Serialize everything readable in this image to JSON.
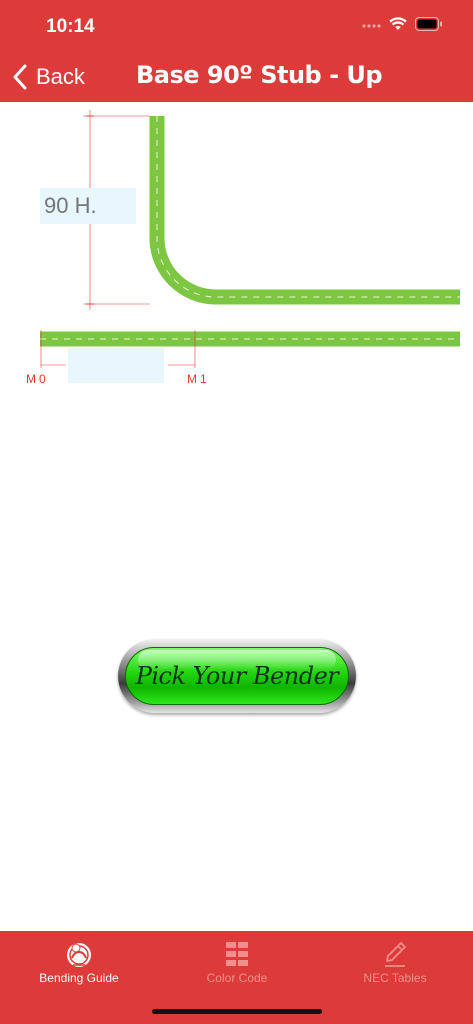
{
  "status_bar": {
    "time": "10:14",
    "icons": [
      "signal-icon",
      "wifi-icon",
      "battery-icon"
    ]
  },
  "nav": {
    "back_label": "Back",
    "title": "Base 90º Stub - Up"
  },
  "diagram": {
    "height_placeholder": "90 H.",
    "length_placeholder": "",
    "mark_start": "M0",
    "mark_end": "M1",
    "conduit_color": "#7dc642",
    "dimension_color": "#e53935"
  },
  "bender_button": {
    "label": "Pick Your Bender"
  },
  "tab_bar": {
    "tabs": [
      {
        "label": "Bending Guide",
        "icon": "bender-logo-icon",
        "active": true
      },
      {
        "label": "Color Code",
        "icon": "grid-icon",
        "active": false
      },
      {
        "label": "NEC Tables",
        "icon": "pencil-icon",
        "active": false
      }
    ]
  },
  "colors": {
    "brand": "#dd3b39",
    "input_bg": "#e8f6fd",
    "button_green": "#22d40d"
  }
}
